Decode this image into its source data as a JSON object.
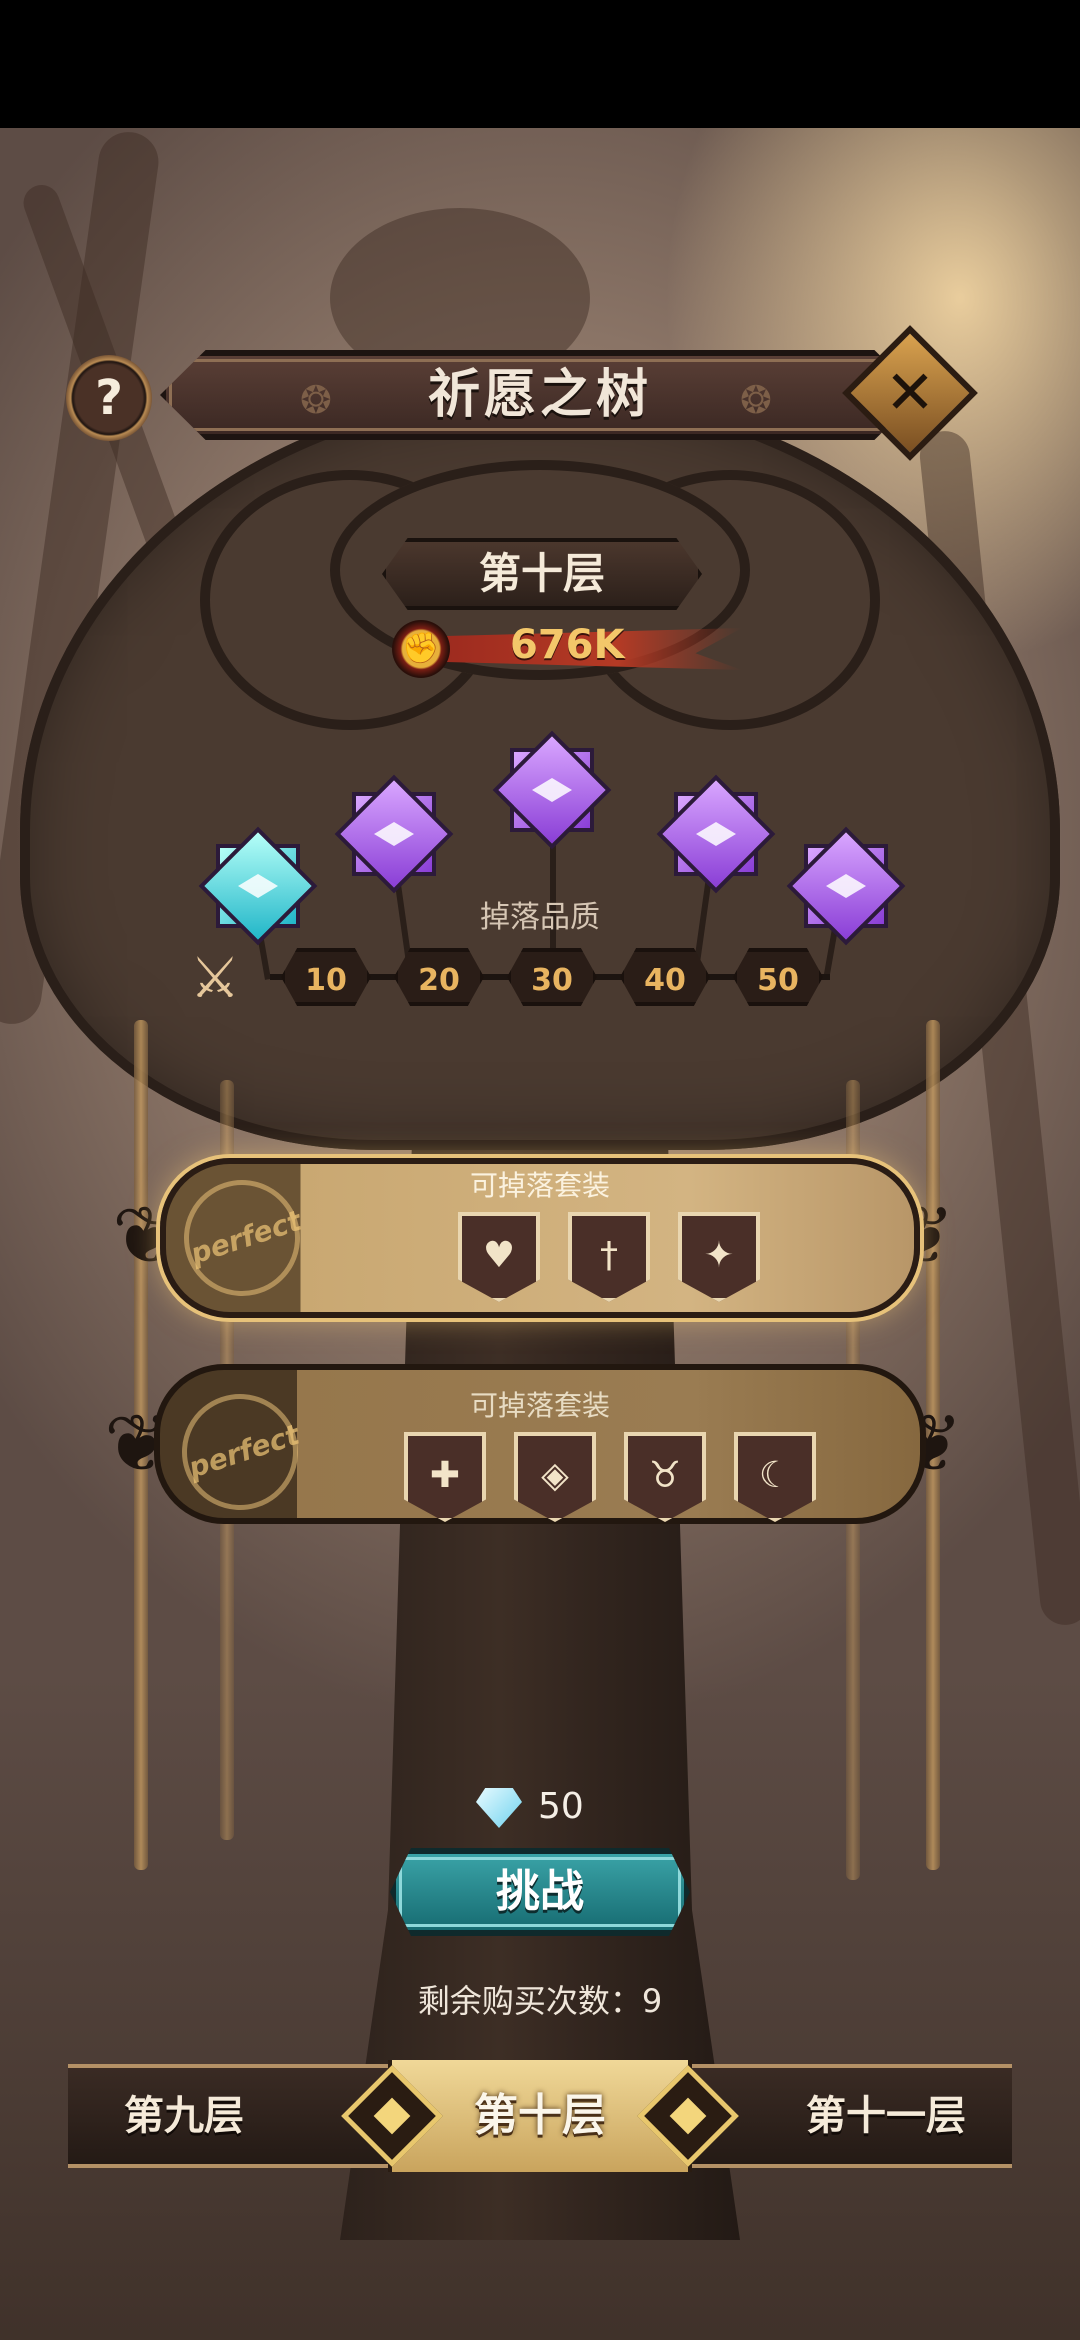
{
  "header": {
    "title": "祈愿之树",
    "help_glyph": "?",
    "close_glyph": "✕"
  },
  "floor": {
    "current_label": "第十层",
    "power_value": "676K"
  },
  "drop": {
    "quality_label": "掉落品质",
    "levels": [
      "10",
      "20",
      "30",
      "40",
      "50"
    ],
    "gems": [
      {
        "color": "cyan",
        "icon": "gem-icon"
      },
      {
        "color": "purple",
        "icon": "gem-icon"
      },
      {
        "color": "purple",
        "icon": "gem-icon"
      },
      {
        "color": "purple",
        "icon": "gem-icon"
      },
      {
        "color": "purple",
        "icon": "gem-icon"
      }
    ]
  },
  "sets": [
    {
      "label": "可掉落套装",
      "seal": "perfect",
      "icons": [
        "heart-shield-icon",
        "sword-shield-icon",
        "star-shield-icon"
      ]
    },
    {
      "label": "可掉落套装",
      "seal": "perfect",
      "icons": [
        "cross-shield-icon",
        "eye-shield-icon",
        "horns-shield-icon",
        "swirl-shield-icon"
      ]
    }
  ],
  "challenge": {
    "cost": "50",
    "button_label": "挑战",
    "remaining": "剩余购买次数：9"
  },
  "nav": {
    "prev": "第九层",
    "current": "第十层",
    "next": "第十一层"
  },
  "colors": {
    "accent_gold": "#e8c76d",
    "challenge_teal": "#1f8f94",
    "power_red": "#b43a25"
  }
}
